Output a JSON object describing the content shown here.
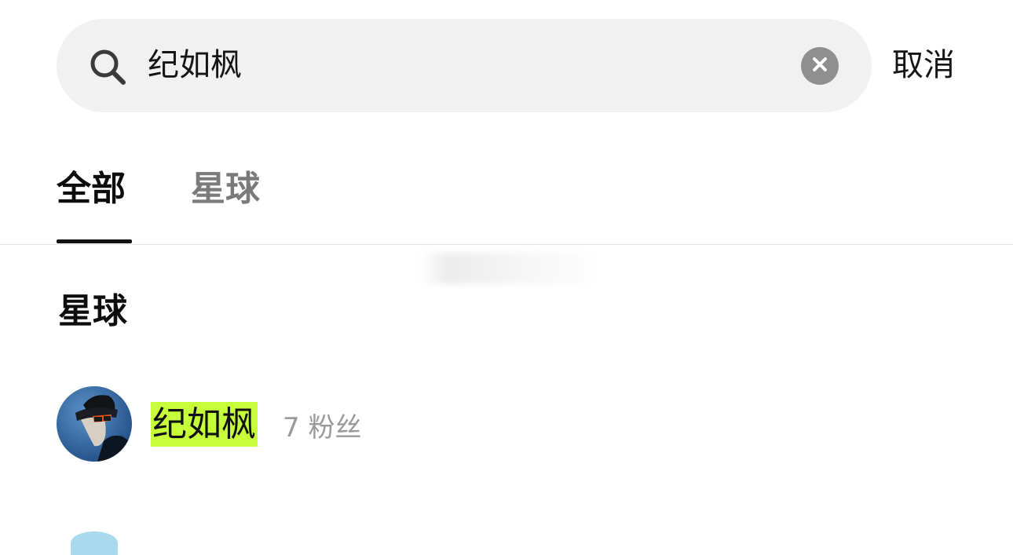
{
  "search": {
    "value": "纪如枫",
    "cancel_label": "取消"
  },
  "tabs": [
    {
      "label": "全部",
      "active": true
    },
    {
      "label": "星球",
      "active": false
    }
  ],
  "section": {
    "title": "星球"
  },
  "results": [
    {
      "name": "纪如枫",
      "meta": "7 粉丝",
      "highlight_color": "#c6ff3a"
    }
  ],
  "icons": {
    "search": "search-icon",
    "clear": "close-icon"
  },
  "colors": {
    "search_bg": "#f1f1f1",
    "clear_button": "#8f8f8f",
    "tab_active": "#0d0d0d",
    "tab_inactive": "#7a7a7a",
    "meta_text": "#9a9a9a",
    "match_highlight": "#c6ff3a"
  }
}
